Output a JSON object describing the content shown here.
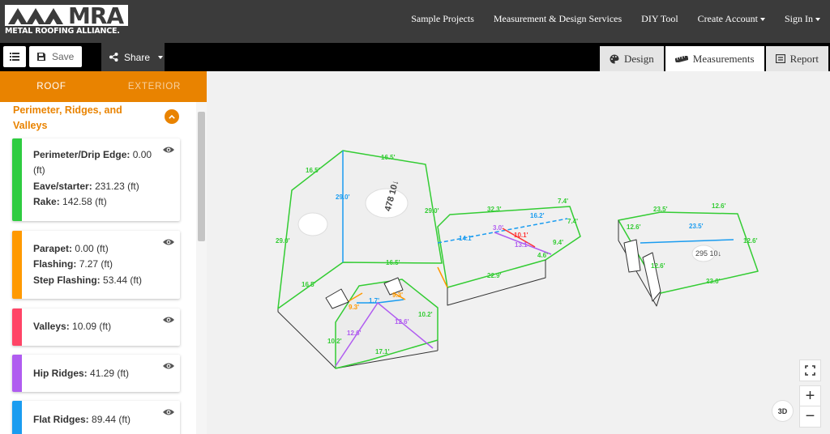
{
  "brand": {
    "logo_text": "MRA",
    "logo_subtitle": "METAL ROOFING ALLIANCE."
  },
  "nav": {
    "links": [
      {
        "label": "Sample Projects"
      },
      {
        "label": "Measurement & Design Services"
      },
      {
        "label": "DIY Tool"
      },
      {
        "label": "Create Account"
      },
      {
        "label": "Sign In"
      }
    ]
  },
  "toolbar": {
    "save_label": "Save",
    "share_label": "Share",
    "tabs": [
      {
        "label": "Design",
        "icon": "palette-icon"
      },
      {
        "label": "Measurements",
        "icon": "ruler-icon",
        "active": true
      },
      {
        "label": "Report",
        "icon": "report-icon"
      }
    ]
  },
  "sidebar": {
    "tabs": [
      {
        "label": "ROOF",
        "active": true
      },
      {
        "label": "EXTERIOR",
        "active": false
      }
    ],
    "section_title": "Perimeter, Ridges, and Valleys",
    "cards": [
      {
        "color": "#2ecc40",
        "lines": [
          {
            "label": "Perimeter/Drip Edge:",
            "value": "0.00 (ft)"
          },
          {
            "label": "Eave/starter:",
            "value": "231.23 (ft)"
          },
          {
            "label": "Rake:",
            "value": "142.58 (ft)"
          }
        ]
      },
      {
        "color": "#ff9900",
        "lines": [
          {
            "label": "Parapet:",
            "value": "0.00 (ft)"
          },
          {
            "label": "Flashing:",
            "value": "7.27 (ft)"
          },
          {
            "label": "Step Flashing:",
            "value": "53.44 (ft)"
          }
        ]
      },
      {
        "color": "#ff4466",
        "lines": [
          {
            "label": "Valleys:",
            "value": "10.09 (ft)"
          }
        ]
      },
      {
        "color": "#b05cf0",
        "lines": [
          {
            "label": "Hip Ridges:",
            "value": "41.29 (ft)"
          }
        ]
      },
      {
        "color": "#1a9cf0",
        "lines": [
          {
            "label": "Flat Ridges:",
            "value": "89.44 (ft)"
          }
        ]
      }
    ]
  },
  "viewer": {
    "controls": {
      "zoom_in": "+",
      "zoom_out": "−",
      "view_3d": "3D"
    },
    "colors": {
      "eave": "#33cc33",
      "ridge": "#1a9cf0",
      "hip": "#b05cf0",
      "valley": "#ff3333",
      "flashing": "#ff9900"
    },
    "facet_labels": [
      "478 10↓",
      "295 10↓"
    ],
    "measurements": [
      "16.5'",
      "16.5'",
      "29.0'",
      "29.0'",
      "29.0'",
      "16.5'",
      "16.5'",
      "32.3'",
      "7.4'",
      "16.2'",
      "7.4'",
      "14.1'",
      "3.0'",
      "10.1'",
      "13.1'",
      "9.4'",
      "4.6'",
      "22.9'",
      "9.3'",
      "1.7'",
      "9.3'",
      "12.6'",
      "12.6'",
      "10.2'",
      "10.2'",
      "17.1'",
      "23.5'",
      "12.6'",
      "12.6'",
      "23.5'",
      "12.6'",
      "12.6'",
      "23.6'"
    ]
  }
}
